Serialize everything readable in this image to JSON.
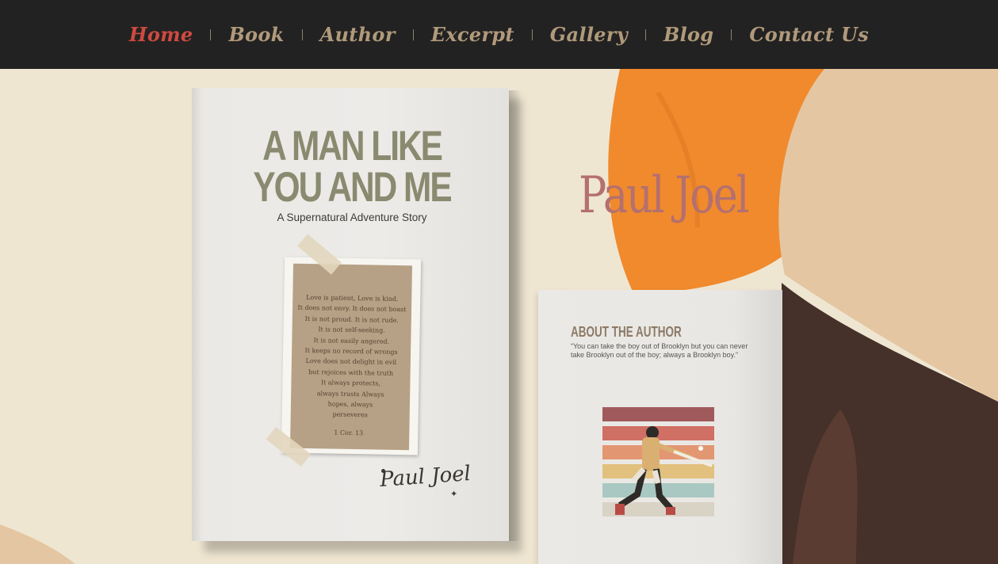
{
  "nav": {
    "items": [
      {
        "label": "Home",
        "active": true
      },
      {
        "label": "Book",
        "active": false
      },
      {
        "label": "Author",
        "active": false
      },
      {
        "label": "Excerpt",
        "active": false
      },
      {
        "label": "Gallery",
        "active": false
      },
      {
        "label": "Blog",
        "active": false
      },
      {
        "label": "Contact Us",
        "active": false
      }
    ]
  },
  "book": {
    "title_line1": "A MAN LIKE",
    "title_line2": "YOU AND ME",
    "subtitle": "A Supernatural Adventure Story",
    "verse_lines": [
      "Love is patient,   Love is kind.",
      "It does not envy.   It does not boast",
      "It is not proud.  It is not rude.",
      "It is not self-seeking.",
      "It is not easily angered.",
      "It keeps no record of wrongs",
      "Love does not delight in evil",
      "but rejoices with the truth",
      "It always protects,",
      "always trusts  Always",
      "hopes, always",
      "perseveres"
    ],
    "verse_ref": "1 Cor. 13",
    "signature": "Paul Joel"
  },
  "brand": {
    "name": "Paul Joel"
  },
  "about": {
    "heading": "ABOUT THE AUTHOR",
    "quote": "“You can take the boy out of Brooklyn but you can never take Brooklyn out of the boy; always a Brooklyn boy.”"
  },
  "colors": {
    "nav_bg": "#232222",
    "nav_text": "#b09a7b",
    "nav_active": "#cf4a40",
    "page_bg": "#efe6d2",
    "brand": "#b4706f",
    "orange_leaf": "#f08a2d",
    "brown_leaf": "#45302a"
  },
  "icons": {
    "baseball_illustration": "batter-swinging-illustration"
  }
}
